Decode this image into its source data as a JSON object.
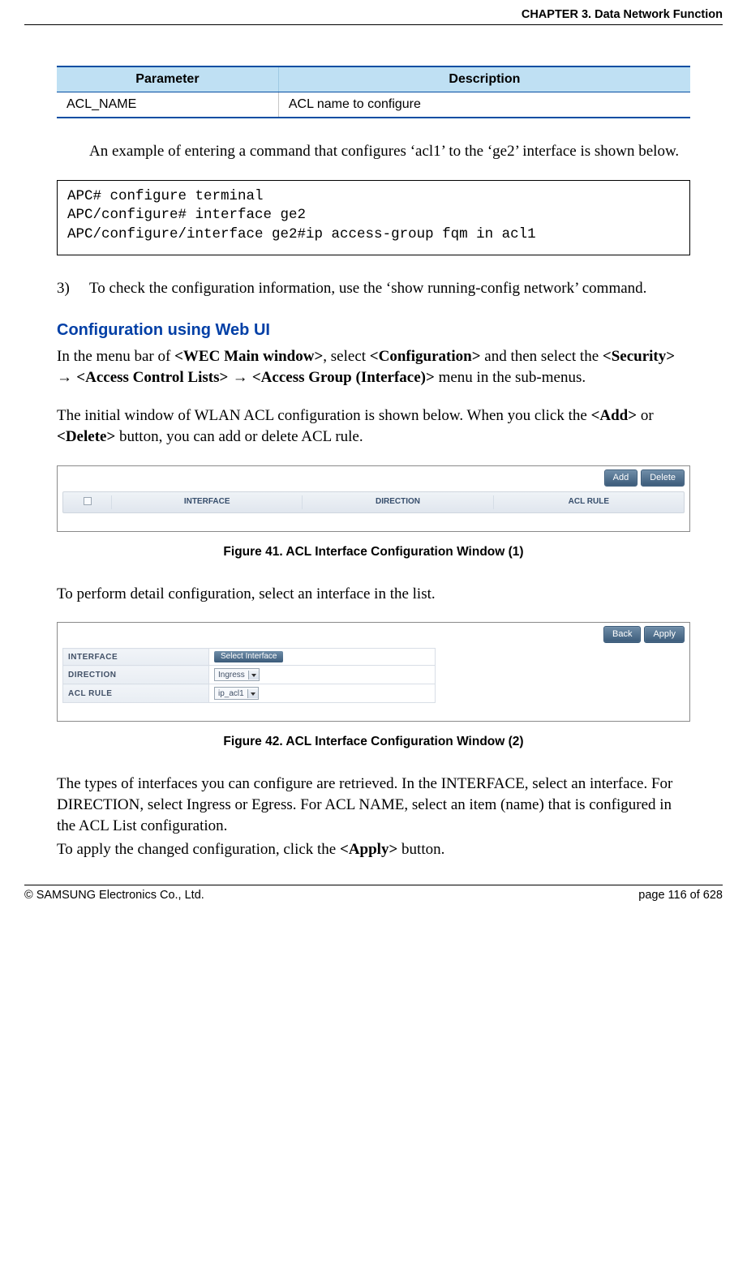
{
  "header": {
    "chapter": "CHAPTER 3. Data Network Function"
  },
  "param_table": {
    "head_param": "Parameter",
    "head_desc": "Description",
    "row1_param": "ACL_NAME",
    "row1_desc": "ACL name to configure"
  },
  "para_example": "An example of entering a command that configures ‘acl1’ to the ‘ge2’ interface is shown below.",
  "code_block": "APC# configure terminal\nAPC/configure# interface ge2\nAPC/configure/interface ge2#ip access-group fqm in acl1",
  "step3": {
    "num": "3)",
    "text": "To check the configuration information, use the ‘show running-config network’ command."
  },
  "subhead": "Configuration using Web UI",
  "webui": {
    "pre": "In the menu bar of ",
    "wec": "<WEC Main window>",
    "mid1": ", select ",
    "conf": "<Configuration>",
    "mid2": " and then select the ",
    "sec": "<Security>",
    "arrow": " → ",
    "acl": "<Access Control Lists>",
    "ag": "<Access Group (Interface)>",
    "tail": " menu in the sub-menus."
  },
  "para_initial_a": "The initial window of WLAN ACL configuration is shown below. When you click the ",
  "para_initial_add": "<Add>",
  "para_initial_or": " or ",
  "para_initial_del": "<Delete>",
  "para_initial_b": " button, you can add or delete ACL rule.",
  "fig41": {
    "btn_add": "Add",
    "btn_delete": "Delete",
    "col_interface": "INTERFACE",
    "col_direction": "DIRECTION",
    "col_aclrule": "ACL RULE",
    "caption": "Figure 41. ACL Interface Configuration Window (1)"
  },
  "para_detail": "To perform detail configuration, select an interface in the list.",
  "fig42": {
    "btn_back": "Back",
    "btn_apply": "Apply",
    "label_interface": "INTERFACE",
    "label_direction": "DIRECTION",
    "label_aclrule": "ACL RULE",
    "val_select_interface": "Select Interface",
    "val_direction": "Ingress",
    "val_aclrule": "ip_acl1",
    "caption": "Figure 42. ACL Interface Configuration Window (2)"
  },
  "para_types": "The types of interfaces you can configure are retrieved. In the INTERFACE, select an interface. For DIRECTION, select Ingress or Egress. For ACL NAME, select an item (name) that is configured in the ACL List configuration.",
  "para_apply_a": "To apply the changed configuration, click the ",
  "para_apply_btn": "<Apply>",
  "para_apply_b": " button.",
  "footer": {
    "copyright": "© SAMSUNG Electronics Co., Ltd.",
    "page": "page 116 of 628"
  }
}
